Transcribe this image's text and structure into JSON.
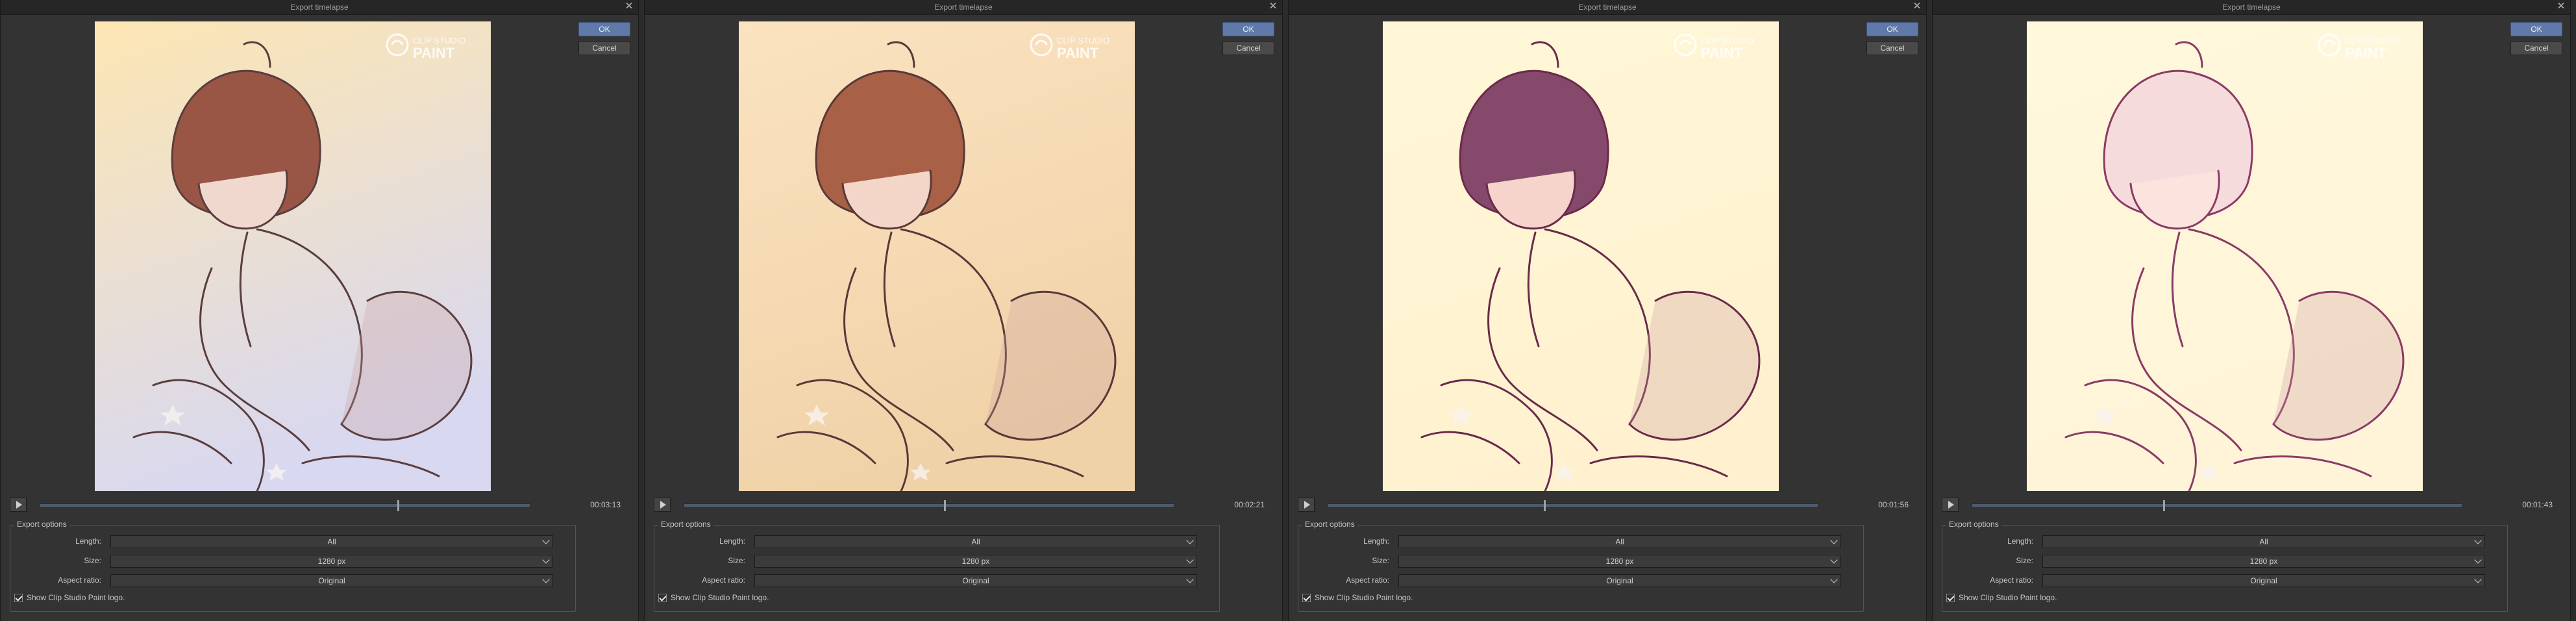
{
  "dialog": {
    "title": "Export timelapse",
    "ok_label": "OK",
    "cancel_label": "Cancel",
    "logo_line1": "CLIP STUDIO",
    "logo_line2": "PAINT",
    "group_title": "Export options",
    "length_label": "Length:",
    "size_label": "Size:",
    "aspect_label": "Aspect ratio:",
    "length_value": "All",
    "size_value": "1280 px",
    "aspect_value": "Original",
    "show_logo_label": "Show Clip Studio Paint logo."
  },
  "panels": [
    {
      "time": "00:03:13",
      "progress": 0.73,
      "bg_top": "#fde6b3",
      "bg_bottom": "#d8d8f0",
      "line": "#5a3e3e",
      "hair": "#8a3d2e",
      "skin": "#f0d8cf",
      "palette": "warm"
    },
    {
      "time": "00:02:21",
      "progress": 0.53,
      "bg_top": "#fbe3c0",
      "bg_bottom": "#f0d2a8",
      "line": "#5a3838",
      "hair": "#9a4a33",
      "skin": "#f3d6c8",
      "palette": "peach"
    },
    {
      "time": "00:01:56",
      "progress": 0.44,
      "bg_top": "#fff7d8",
      "bg_bottom": "#fff1cf",
      "line": "#6a2a4a",
      "hair": "#6e2a58",
      "skin": "#f6d4cc",
      "palette": "magenta"
    },
    {
      "time": "00:01:43",
      "progress": 0.39,
      "bg_top": "#fff8dc",
      "bg_bottom": "#fff4d8",
      "line": "#8a3a66",
      "hair": "#f4d6dc",
      "skin": "#fbe4de",
      "palette": "pink"
    }
  ],
  "colors": {
    "accent": "#5f7aa8",
    "panel": "#333333"
  }
}
